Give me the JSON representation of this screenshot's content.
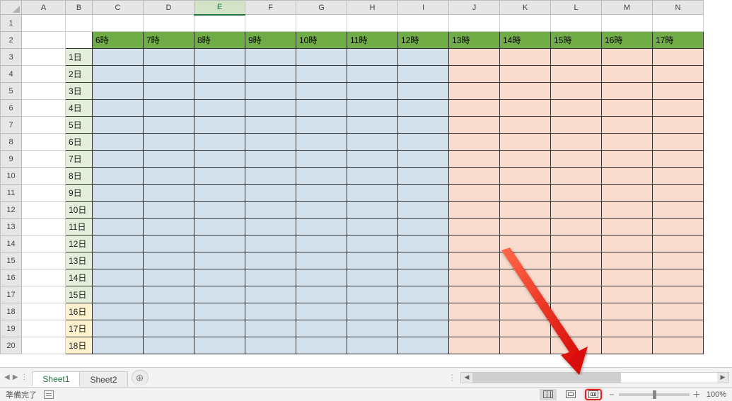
{
  "columns": [
    "A",
    "B",
    "C",
    "D",
    "E",
    "F",
    "G",
    "H",
    "I",
    "J",
    "K",
    "L",
    "M",
    "N"
  ],
  "selected_col_index": 4,
  "row_numbers": [
    1,
    2,
    3,
    4,
    5,
    6,
    7,
    8,
    9,
    10,
    11,
    12,
    13,
    14,
    15,
    16,
    17,
    18,
    19,
    20
  ],
  "header_times": [
    "6時",
    "7時",
    "8時",
    "9時",
    "10時",
    "11時",
    "12時",
    "13時",
    "14時",
    "15時",
    "16時",
    "17時"
  ],
  "days": [
    "1日",
    "2日",
    "3日",
    "4日",
    "5日",
    "6日",
    "7日",
    "8日",
    "9日",
    "10日",
    "11日",
    "12日",
    "13日",
    "14日",
    "15日",
    "16日",
    "17日",
    "18日"
  ],
  "day_yellow_from_index": 15,
  "blue_count": 7,
  "pink_count": 5,
  "tabs": {
    "items": [
      "Sheet1",
      "Sheet2"
    ],
    "active_index": 0,
    "new_label": "⊕"
  },
  "status": {
    "ready": "準備完了",
    "zoom": "100%",
    "minus": "−",
    "plus": "＋"
  },
  "scroll": {
    "left_arrow": "◀",
    "right_arrow": "▶",
    "nav_first": "◀",
    "nav_prev": "▶",
    "sep": "⋮"
  }
}
